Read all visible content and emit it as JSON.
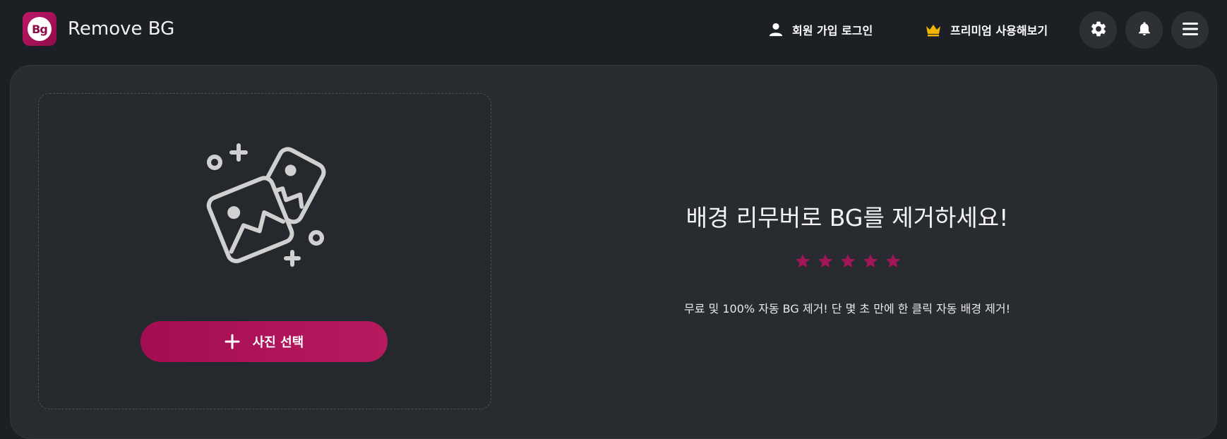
{
  "header": {
    "logo_text": "Bg",
    "title": "Remove BG",
    "login_label": "회원 가입 로그인",
    "premium_label": "프리미엄 사용해보기",
    "icons": {
      "user": "user-icon",
      "crown": "crown-icon",
      "settings": "gear-icon",
      "bell": "bell-icon",
      "menu": "hamburger-menu-icon"
    }
  },
  "upload": {
    "button_label": "사진 선택",
    "illustration": "images-icon"
  },
  "promo": {
    "headline": "배경 리무버로 BG를 제거하세요!",
    "rating": 5,
    "description": "무료 및 100% 자동 BG 제거! 단 몇 초 만에 한 클릭 자동 배경 제거!"
  },
  "colors": {
    "accent": "#a30d52",
    "star": "#a3165a",
    "crown": "#f2b705",
    "background": "#1c1f23",
    "card": "#282b30"
  }
}
